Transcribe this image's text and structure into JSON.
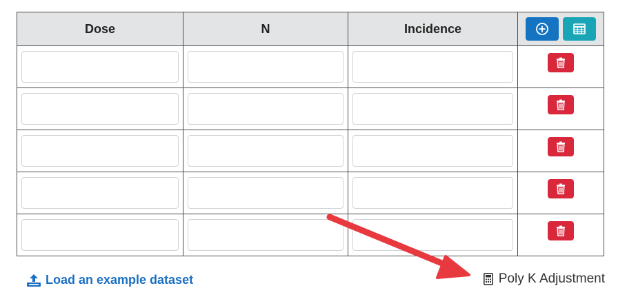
{
  "table": {
    "columns": [
      "Dose",
      "N",
      "Incidence"
    ],
    "rows": [
      {
        "dose": "",
        "n": "",
        "incidence": ""
      },
      {
        "dose": "",
        "n": "",
        "incidence": ""
      },
      {
        "dose": "",
        "n": "",
        "incidence": ""
      },
      {
        "dose": "",
        "n": "",
        "incidence": ""
      },
      {
        "dose": "",
        "n": "",
        "incidence": ""
      }
    ],
    "add_row_icon": "plus-circle-icon",
    "table_icon": "table-icon",
    "delete_icon": "trash-icon"
  },
  "footer": {
    "example_link": "Load an example dataset",
    "example_icon": "upload-icon",
    "polyk_label": "Poly K Adjustment",
    "polyk_icon": "calculator-icon"
  },
  "colors": {
    "primary": "#1474c2",
    "info": "#1aa5b6",
    "danger": "#d9283b",
    "header_bg": "#e3e4e6",
    "annotation_arrow": "#e8393f"
  }
}
